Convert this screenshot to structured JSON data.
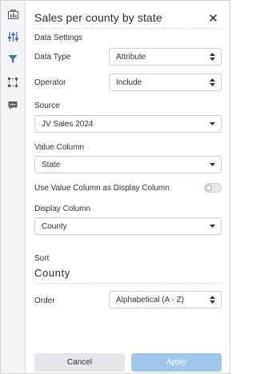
{
  "panel": {
    "title": "Sales per county by state"
  },
  "data_settings": {
    "heading": "Data Settings",
    "data_type": {
      "label": "Data Type",
      "value": "Attribute"
    },
    "operator": {
      "label": "Operator",
      "value": "Include"
    },
    "source": {
      "label": "Source",
      "value": "JV Sales 2024"
    },
    "value_column": {
      "label": "Value Column",
      "value": "State"
    },
    "use_value_as_display": {
      "label": "Use Value Column as Display Column",
      "enabled": false
    },
    "display_column": {
      "label": "Display Column",
      "value": "County"
    }
  },
  "sort": {
    "label": "Sort",
    "value": "County",
    "order": {
      "label": "Order",
      "value": "Alphabetical (A - Z)"
    }
  },
  "footer": {
    "cancel_label": "Cancel",
    "apply_label": "Apply"
  },
  "rail": {
    "items": [
      "chart-icon",
      "sliders-icon",
      "filter-icon",
      "selection-icon",
      "comment-icon"
    ]
  },
  "colors": {
    "rail_icon": "#5b6068",
    "active_icon": "#3a6fb0",
    "apply_button": "#9ec7ea",
    "cancel_button": "#e4e6e9"
  }
}
